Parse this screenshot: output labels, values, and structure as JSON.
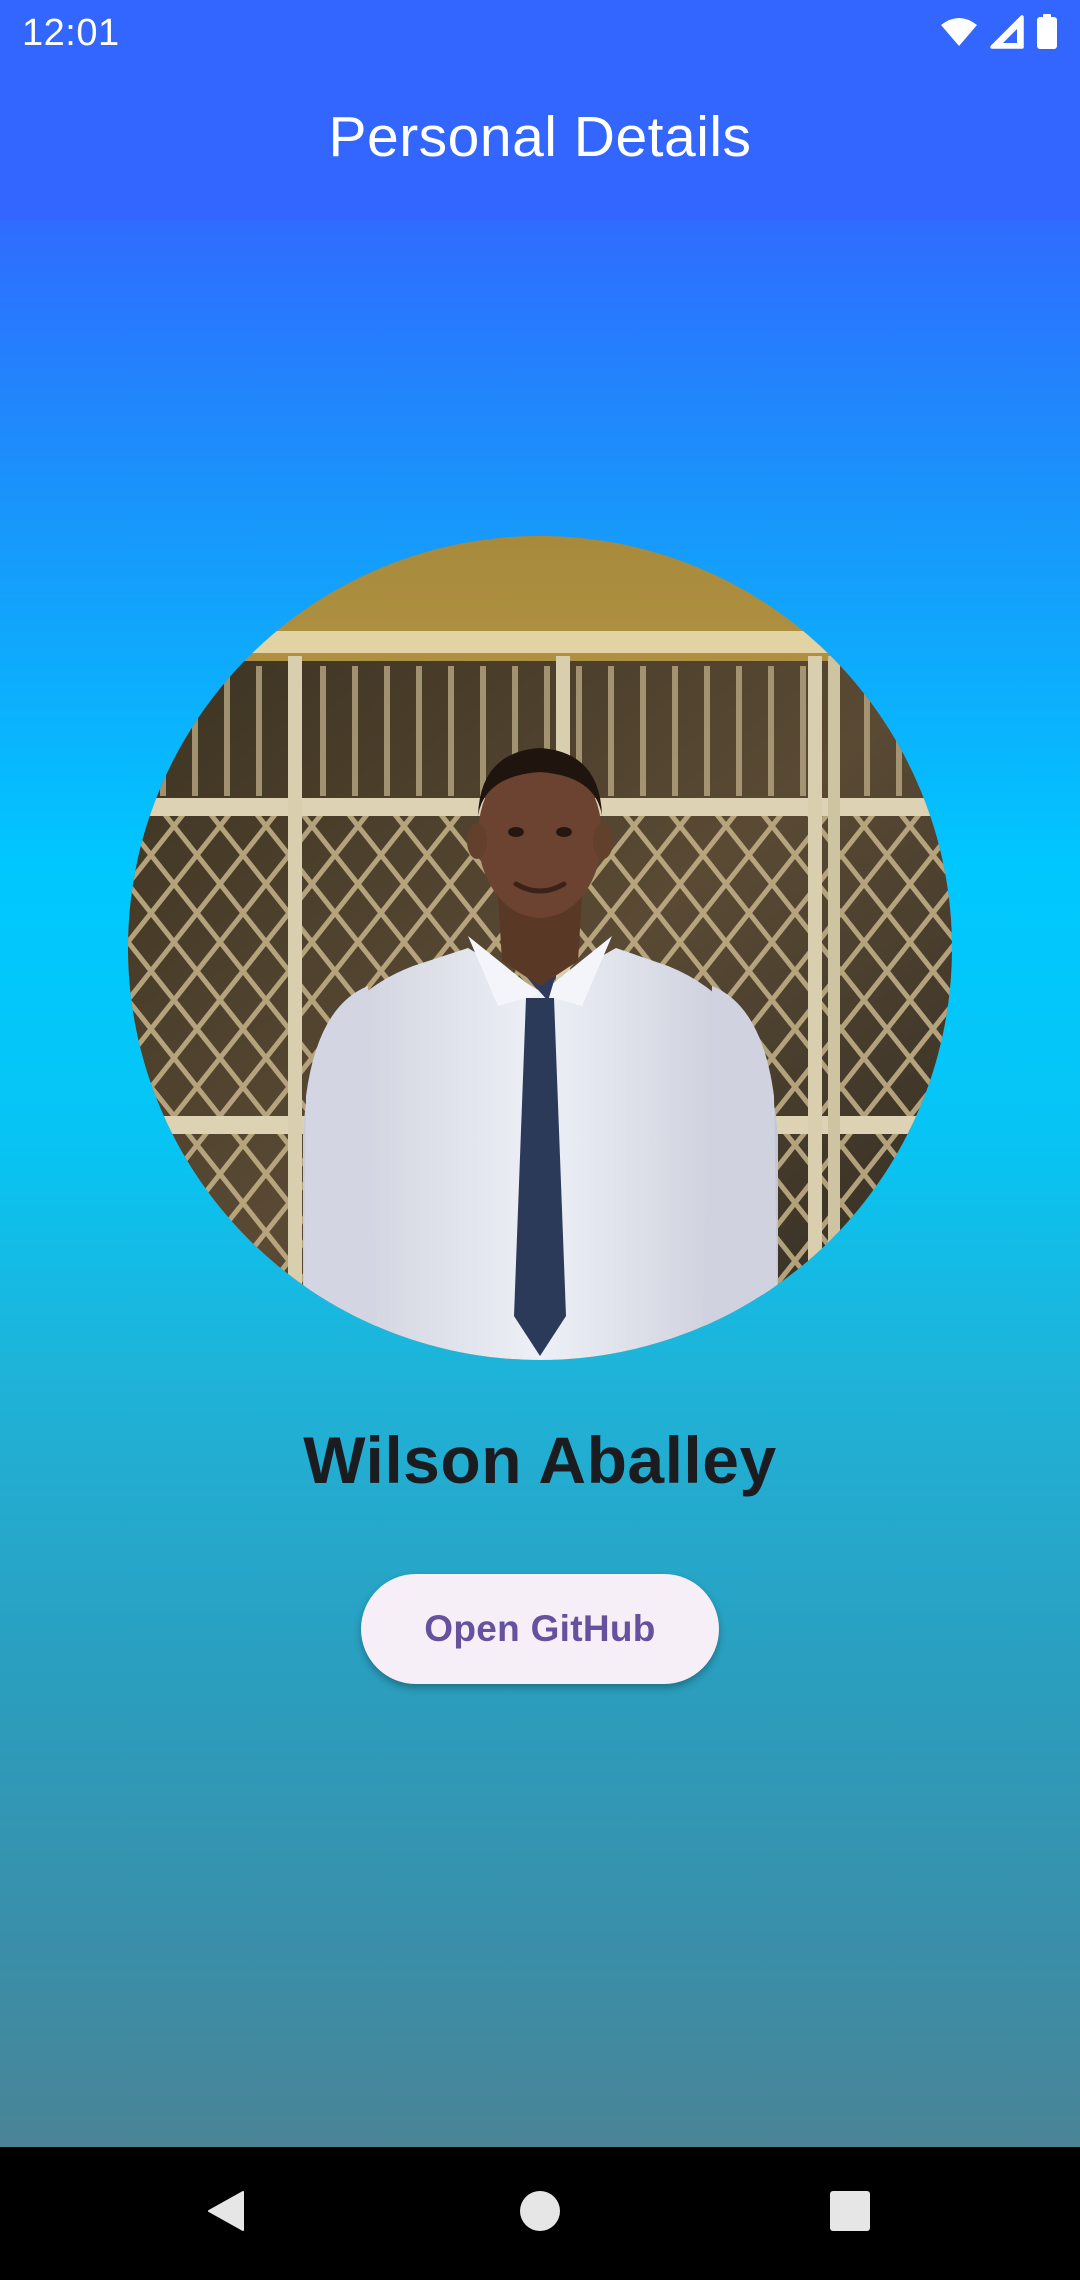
{
  "status_bar": {
    "time": "12:01",
    "icons": [
      "wifi-icon",
      "cell-signal-icon",
      "battery-icon"
    ]
  },
  "app_bar": {
    "title": "Personal Details",
    "background": "#3366ff"
  },
  "profile": {
    "name": "Wilson Aballey",
    "photo": "profile-photo"
  },
  "actions": {
    "github_button_label": "Open GitHub"
  },
  "nav_bar": {
    "buttons": [
      "back-icon",
      "home-icon",
      "recents-icon"
    ]
  },
  "colors": {
    "app_bar": "#3366ff",
    "gradient_top": "#2f6cff",
    "gradient_mid": "#00c8ff",
    "gradient_bottom": "#4a8496",
    "button_bg": "#f6eff8",
    "button_text": "#66519e",
    "name_text": "#1b1c20"
  }
}
